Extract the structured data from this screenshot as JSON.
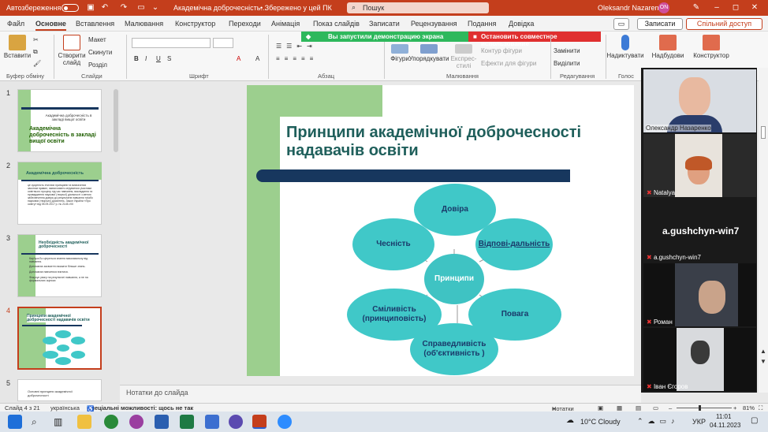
{
  "titlebar": {
    "autosave": "Автозбереження",
    "doc_title": "Академічна доброчесність...",
    "saved": "• Збережено у цей ПК",
    "search": "Пошук",
    "user": "Oleksandr Nazarenko",
    "avatar_initials": "ON"
  },
  "menu": {
    "file": "Файл",
    "home": "Основне",
    "insert": "Вставлення",
    "draw": "Малювання",
    "design": "Конструктор",
    "transitions": "Переходи",
    "animations": "Анімація",
    "slideshow": "Показ слайдів",
    "record": "Записати",
    "review": "Рецензування",
    "view": "Подання",
    "help": "Довідка",
    "record_btn": "Записати",
    "share_btn": "Спільний доступ"
  },
  "zoom": {
    "sharing": "Вы запустили демонстрацию экрана",
    "stop": "Остановить совместное использование"
  },
  "ribbon": {
    "paste": "Вставити",
    "new_slide": "Створити слайд",
    "layout": "Макет",
    "reset": "Скинути",
    "section": "Розділ",
    "shapes": "Фігури",
    "arrange": "Упорядкувати",
    "quick_styles": "Експрес-стилі",
    "shape_outline": "Контур фігури",
    "shape_effects": "Ефекти для фігури",
    "replace": "Замінити",
    "select": "Виділити",
    "dictate": "Надиктувати",
    "addins": "Надбудови",
    "designer": "Конструктор",
    "g_clipboard": "Буфер обміну",
    "g_slides": "Слайди",
    "g_font": "Шрифт",
    "g_paragraph": "Абзац",
    "g_drawing": "Малювання",
    "g_editing": "Редагування",
    "g_voice": "Голос"
  },
  "thumbs": [
    {
      "num": "1",
      "title": "Академічна доброчесність в закладі вищої освіти",
      "subtitle": "Академічна доброчесність в закладі вищої освіти"
    },
    {
      "num": "2",
      "title": "Академічна доброчесність",
      "body": "це сукупність етичних принципів та визначених законом правил, якими мають керуватися учасники освітнього процесу під час навчання, викладання та провадження наукової (творчої) діяльності з метою забезпечення довіри до результатів навчання та/або наукових (творчих) досягнень. Закон України «Про освіту» від 05.09.2017 р. № 2145-VIII"
    },
    {
      "num": "3",
      "title": "Необхідність академічної доброчесності",
      "bullets": [
        "Кар'єра.Бо цінується знання максимальну від навчання.",
        "Допомагає засвоєтти вказати більше знань.",
        "Допомагає навчитися вчитися.",
        "Фокусує увагу на результаті навчання, а не на формальних оцінках"
      ]
    },
    {
      "num": "4",
      "title": "Принципи академічної доброчесності надавачів освіти"
    },
    {
      "num": "5",
      "title": "Основні принципи академічної доброчесності"
    }
  ],
  "slide": {
    "title": "Принципи академічної доброчесності надавачів освіти",
    "center": "Принципи",
    "nodes": [
      "Довіра",
      "Відпові-дальність",
      "Повага",
      "Справедливість (об'єктивність )",
      "Сміливість (принциповість)",
      "Чесність"
    ]
  },
  "notes": "Нотатки до слайда",
  "status": {
    "slide_of": "Слайд 4 з 21",
    "lang": "українська",
    "access": "Спеціальні можливості: щось не так",
    "notes": "Нотатки",
    "zoom": "81%"
  },
  "participants": [
    {
      "name": "Олександр Назаренко"
    },
    {
      "name": "Natalya"
    },
    {
      "name": "a.gushchyn-win7",
      "big": "a.gushchyn-win7"
    },
    {
      "name": "Роман"
    },
    {
      "name": "Іван Єгоров"
    }
  ],
  "taskbar": {
    "weather": "10°C Cloudy",
    "lang": "УКР",
    "time": "11:01",
    "date": "04.11.2023"
  }
}
